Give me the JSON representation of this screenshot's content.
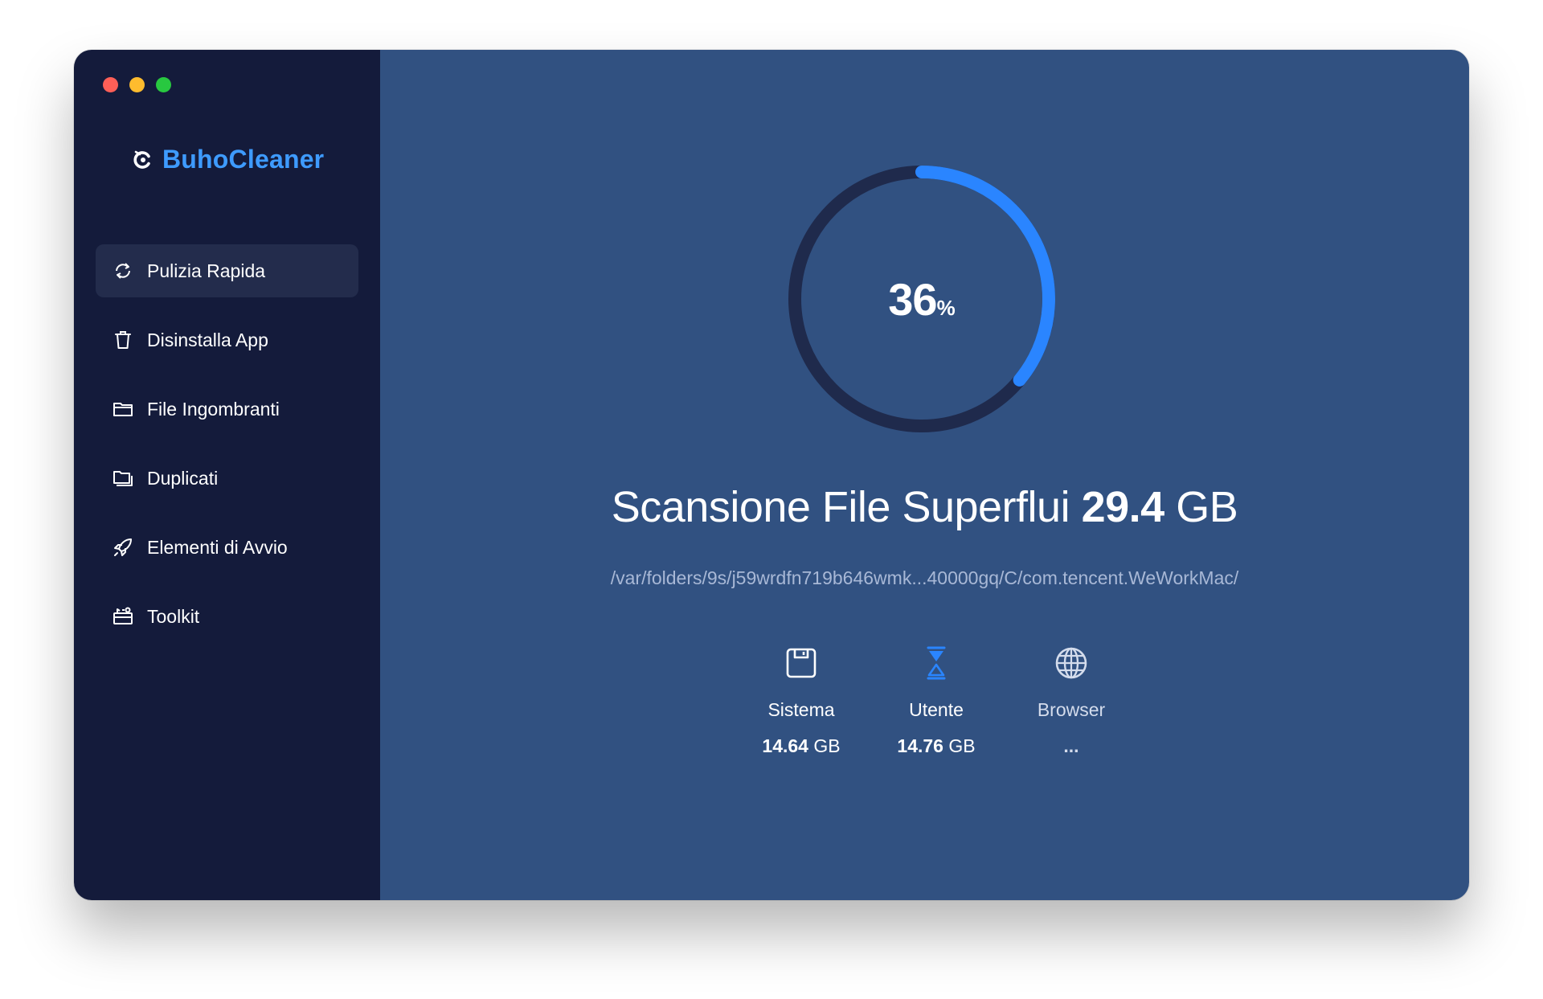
{
  "app": {
    "name": "BuhoCleaner"
  },
  "sidebar": {
    "items": [
      {
        "label": "Pulizia Rapida",
        "icon": "refresh-icon",
        "active": true
      },
      {
        "label": "Disinstalla App",
        "icon": "trash-icon",
        "active": false
      },
      {
        "label": "File Ingombranti",
        "icon": "folder-icon",
        "active": false
      },
      {
        "label": "Duplicati",
        "icon": "duplicate-folder-icon",
        "active": false
      },
      {
        "label": "Elementi di Avvio",
        "icon": "rocket-icon",
        "active": false
      },
      {
        "label": "Toolkit",
        "icon": "toolbox-icon",
        "active": false
      }
    ]
  },
  "scan": {
    "progress_number": "36",
    "progress_unit": "%",
    "progress_fraction": 0.36,
    "title_text": "Scansione File Superflui",
    "total_size_number": "29.4",
    "total_size_unit": "GB",
    "current_path": "/var/folders/9s/j59wrdfn719b646wmk...40000gq/C/com.tencent.WeWorkMac/"
  },
  "stats": [
    {
      "label": "Sistema",
      "value_number": "14.64",
      "value_unit": "GB",
      "icon": "disk-icon"
    },
    {
      "label": "Utente",
      "value_number": "14.76",
      "value_unit": "GB",
      "icon": "hourglass-icon"
    },
    {
      "label": "Browser",
      "value_number": "...",
      "value_unit": "",
      "icon": "globe-icon"
    }
  ],
  "colors": {
    "sidebar_bg": "#141b3b",
    "main_bg": "#315181",
    "accent": "#2a85ff",
    "brand": "#3e9bff",
    "ring_track": "#1f2a4c"
  }
}
